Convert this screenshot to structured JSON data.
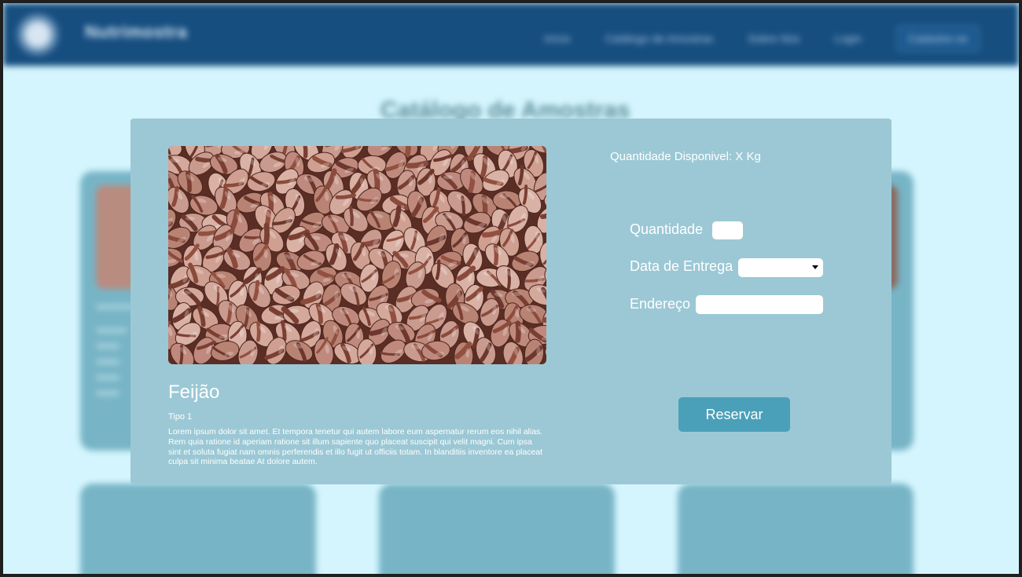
{
  "navbar": {
    "brand": "Nutrimostra",
    "links": [
      "Início",
      "Catálogo de Amostras",
      "Sobre Nós",
      "Login"
    ],
    "cta": "Cadastre-se"
  },
  "background": {
    "title": "Catálogo de Amostras"
  },
  "modal": {
    "product_name": "Feijão",
    "product_type": "Tipo 1",
    "description": "Lorem ipsum dolor sit amet. Et tempora tenetur qui autem labore eum aspernatur rerum eos nihil alias. Rem quia ratione id aperiam ratione sit illum sapiente quo placeat suscipit qui velit magni. Cum ipsa sint et soluta fugiat nam omnis perferendis et illo fugit ut officiis totam. In blanditiis inventore ea placeat culpa sit minima beatae At dolore autem.",
    "quantity_available": "Quantidade Disponivel: X Kg",
    "form": {
      "quantity_label": "Quantidade",
      "quantity_value": "",
      "delivery_date_label": "Data de Entrega",
      "delivery_date_value": "",
      "address_label": "Endereço",
      "address_value": ""
    },
    "reserve_label": "Reservar"
  },
  "colors": {
    "navbar": "#164e80",
    "page_background": "#d4f5fd",
    "modal_background": "#9cc8d5",
    "button": "#4aa0b8",
    "card": "#77b4c6"
  }
}
